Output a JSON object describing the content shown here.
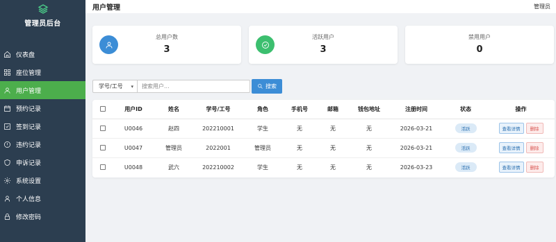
{
  "sidebar": {
    "brand_title": "管理员后台",
    "items": [
      {
        "label": "仪表盘",
        "icon": "home-icon",
        "active": false
      },
      {
        "label": "座位管理",
        "icon": "grid-icon",
        "active": false
      },
      {
        "label": "用户管理",
        "icon": "user-icon",
        "active": true
      },
      {
        "label": "预约记录",
        "icon": "calendar-icon",
        "active": false
      },
      {
        "label": "签到记录",
        "icon": "checkbox-icon",
        "active": false
      },
      {
        "label": "违约记录",
        "icon": "alert-icon",
        "active": false
      },
      {
        "label": "申诉记录",
        "icon": "shield-icon",
        "active": false
      },
      {
        "label": "系统设置",
        "icon": "gear-icon",
        "active": false
      },
      {
        "label": "个人信息",
        "icon": "person-icon",
        "active": false
      },
      {
        "label": "修改密码",
        "icon": "lock-icon",
        "active": false
      }
    ]
  },
  "header": {
    "title": "用户管理",
    "user": "管理员"
  },
  "stats": [
    {
      "label": "总用户数",
      "value": "3",
      "icon": "user-icon",
      "color": "#3c8dd6"
    },
    {
      "label": "活跃用户",
      "value": "3",
      "icon": "check-circle-icon",
      "color": "#3cbf6f"
    },
    {
      "label": "禁用用户",
      "value": "0",
      "icon": "",
      "color": ""
    }
  ],
  "filter": {
    "select_value": "学号/工号",
    "search_placeholder": "搜索用户...",
    "search_button": "搜索"
  },
  "table": {
    "columns": [
      "用户ID",
      "姓名",
      "学号/工号",
      "角色",
      "手机号",
      "邮箱",
      "钱包地址",
      "注册时间",
      "状态",
      "操作"
    ],
    "rows": [
      {
        "id": "U0046",
        "name": "赵四",
        "number": "202210001",
        "role": "学生",
        "phone": "无",
        "email": "无",
        "wallet": "无",
        "registered": "2026-03-21",
        "status": "活跃"
      },
      {
        "id": "U0047",
        "name": "管理员",
        "number": "2022001",
        "role": "管理员",
        "phone": "无",
        "email": "无",
        "wallet": "无",
        "registered": "2026-03-21",
        "status": "活跃"
      },
      {
        "id": "U0048",
        "name": "武六",
        "number": "202210002",
        "role": "学生",
        "phone": "无",
        "email": "无",
        "wallet": "无",
        "registered": "2026-03-23",
        "status": "活跃"
      }
    ],
    "view_label": "查看详情",
    "delete_label": "删除"
  },
  "colors": {
    "sidebar_bg": "#2c3e50",
    "active_item": "#4cae4c",
    "primary": "#3c8dd6"
  }
}
